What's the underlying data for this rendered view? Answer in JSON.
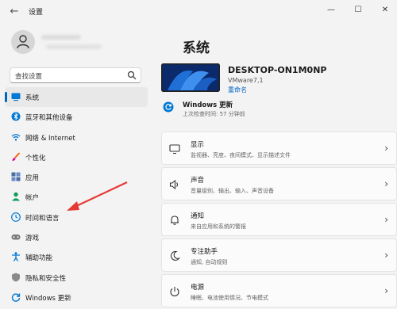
{
  "window": {
    "title": "设置",
    "back_glyph": "←",
    "min_glyph": "—",
    "max_glyph": "☐",
    "close_glyph": "✕"
  },
  "search": {
    "placeholder": "查找设置"
  },
  "sidebar": {
    "items": [
      {
        "label": "系统",
        "icon": "system-icon",
        "selected": true
      },
      {
        "label": "蓝牙和其他设备",
        "icon": "bluetooth-icon"
      },
      {
        "label": "网络 & Internet",
        "icon": "wifi-icon"
      },
      {
        "label": "个性化",
        "icon": "brush-icon"
      },
      {
        "label": "应用",
        "icon": "apps-icon"
      },
      {
        "label": "帐户",
        "icon": "person-icon"
      },
      {
        "label": "时间和语言",
        "icon": "globe-clock-icon"
      },
      {
        "label": "游戏",
        "icon": "game-controller-icon"
      },
      {
        "label": "辅助功能",
        "icon": "accessibility-icon"
      },
      {
        "label": "隐私和安全性",
        "icon": "shield-icon"
      },
      {
        "label": "Windows 更新",
        "icon": "windows-update-icon"
      }
    ]
  },
  "main": {
    "title": "系统",
    "device": {
      "name": "DESKTOP-ON1M0NP",
      "model": "VMware7,1",
      "rename": "重命名"
    },
    "update": {
      "title": "Windows 更新",
      "subtitle": "上次检查时间: 57 分钟前"
    },
    "cards": [
      {
        "title": "显示",
        "desc": "监视器、亮度、夜间模式、显示描述文件",
        "icon": "monitor-icon"
      },
      {
        "title": "声音",
        "desc": "音量级别、输出、输入、声音设备",
        "icon": "speaker-icon"
      },
      {
        "title": "通知",
        "desc": "来自应用和系统的警报",
        "icon": "bell-icon"
      },
      {
        "title": "专注助手",
        "desc": "通知, 自动规则",
        "icon": "moon-icon"
      },
      {
        "title": "电源",
        "desc": "睡眠、电池使用情况、节电模式",
        "icon": "power-icon"
      }
    ]
  },
  "colors": {
    "accent": "#0067c0",
    "annotation_arrow": "#e53935"
  }
}
